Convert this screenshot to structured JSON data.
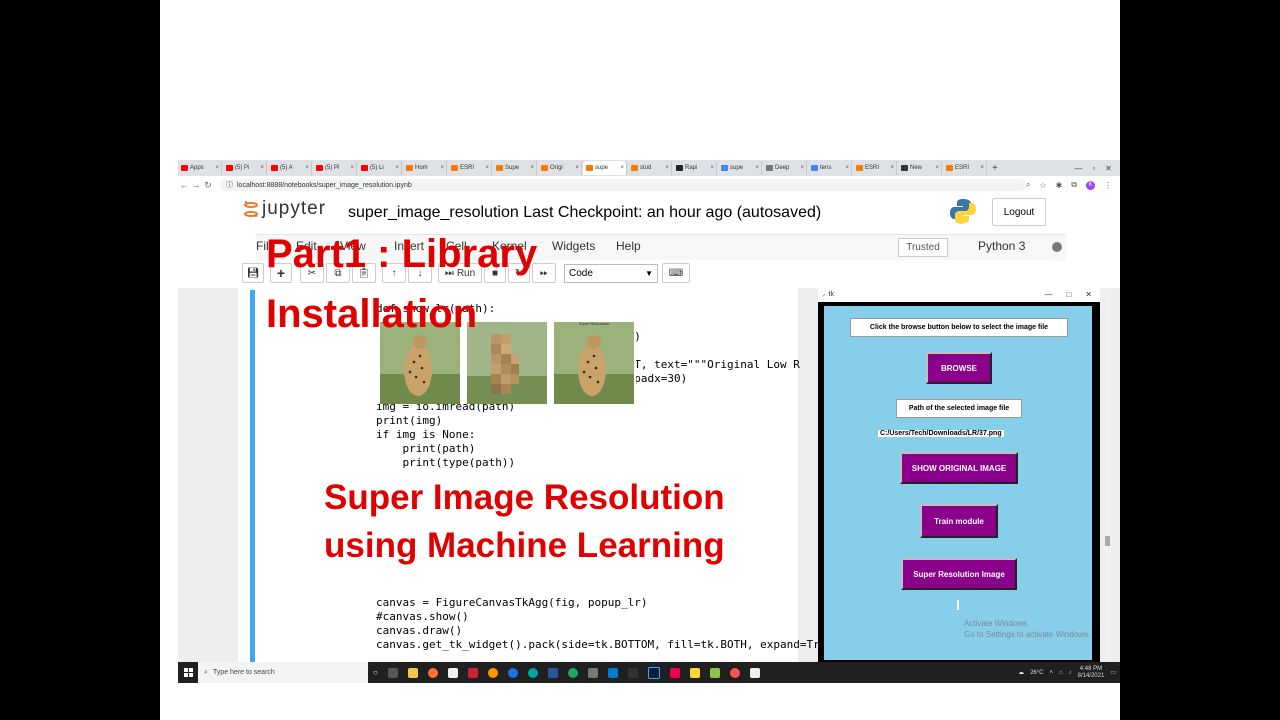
{
  "browser": {
    "tabs": [
      {
        "label": "Apps",
        "color": "#ff0000"
      },
      {
        "label": "(5) Pi",
        "color": "#ff0000"
      },
      {
        "label": "(5) A",
        "color": "#ff0000"
      },
      {
        "label": "(5) Pi",
        "color": "#ff0000"
      },
      {
        "label": "(5) Li",
        "color": "#ff0000"
      },
      {
        "label": "Hom",
        "color": "#f57c00"
      },
      {
        "label": "ESRI",
        "color": "#f57c00"
      },
      {
        "label": "Supe",
        "color": "#f57c00"
      },
      {
        "label": "Origi",
        "color": "#f57c00"
      },
      {
        "label": "supe",
        "color": "#f57c00"
      },
      {
        "label": "stud",
        "color": "#f57c00"
      },
      {
        "label": "Rapi",
        "color": "#222222"
      },
      {
        "label": "supe",
        "color": "#4285f4"
      },
      {
        "label": "Deep",
        "color": "#777777"
      },
      {
        "label": "tens",
        "color": "#4285f4"
      },
      {
        "label": "ESRI",
        "color": "#f57c00"
      },
      {
        "label": "New",
        "color": "#333333"
      },
      {
        "label": "ESRI",
        "color": "#f57c00"
      }
    ],
    "url": "localhost:8888/notebooks/super_image_resolution.ipynb",
    "avatar": "K",
    "window_controls": [
      "—",
      "▫",
      "✕"
    ]
  },
  "jupyter": {
    "logo_text": "jupyter",
    "notebook_title": "super_image_resolution Last Checkpoint: an hour ago  (autosaved)",
    "logout": "Logout",
    "menu": [
      "File",
      "Edit",
      "View",
      "Insert",
      "Cell",
      "Kernel",
      "Widgets",
      "Help"
    ],
    "trusted": "Trusted",
    "kernel": "Python 3",
    "toolbar": {
      "run": "Run",
      "cell_type": "Code"
    }
  },
  "code_lines_top": [
    {
      "text": "def show_lr(path):"
    },
    {
      "text": "    l                                  )"
    },
    {
      "text": "                                    .EFT, text=\"\"\"Original Low R"
    },
    {
      "text": "                                    0, padx=30)"
    }
  ],
  "code_block_mid": "img = io.imread(path)\nprint(img)\nif img is None:\n    print(path)\n    print(type(path))",
  "code_block_bottom": "canvas = FigureCanvasTkAgg(fig, popup_lr)\n#canvas.show()\ncanvas.draw()\ncanvas.get_tk_widget().pack(side=tk.BOTTOM, fill=tk.BOTH, expand=Tr",
  "overlay": {
    "part1_line1": "Part1 : Library",
    "part1_line2": "Installation",
    "banner_line1": "Super Image Resolution",
    "banner_line2": "using Machine Learning"
  },
  "thumbnails": [
    {
      "label": "",
      "style": "sharp"
    },
    {
      "label": "",
      "style": "pixelated"
    },
    {
      "label": "Super Resolution",
      "style": "sharp"
    }
  ],
  "tk_window": {
    "title": "tk",
    "controls": [
      "—",
      "□",
      "✕"
    ],
    "instruction": "Click the browse button below to select the image file",
    "browse": "BROWSE",
    "path_label": "Path of the selected image file",
    "path_value": "C:/Users/Tech/Downloads/LR/37.png",
    "show_original": "SHOW ORIGINAL IMAGE",
    "train": "Train module",
    "super_res": "Super Resolution Image",
    "bg_color": "#87ceeb",
    "button_color": "#8b008b"
  },
  "activate": {
    "line1": "Activate Windows",
    "line2": "Go to Settings to activate Windows."
  },
  "taskbar": {
    "search_placeholder": "Type here to search",
    "temp": "26°C",
    "time": "4:48 PM",
    "date": "8/14/2021"
  }
}
